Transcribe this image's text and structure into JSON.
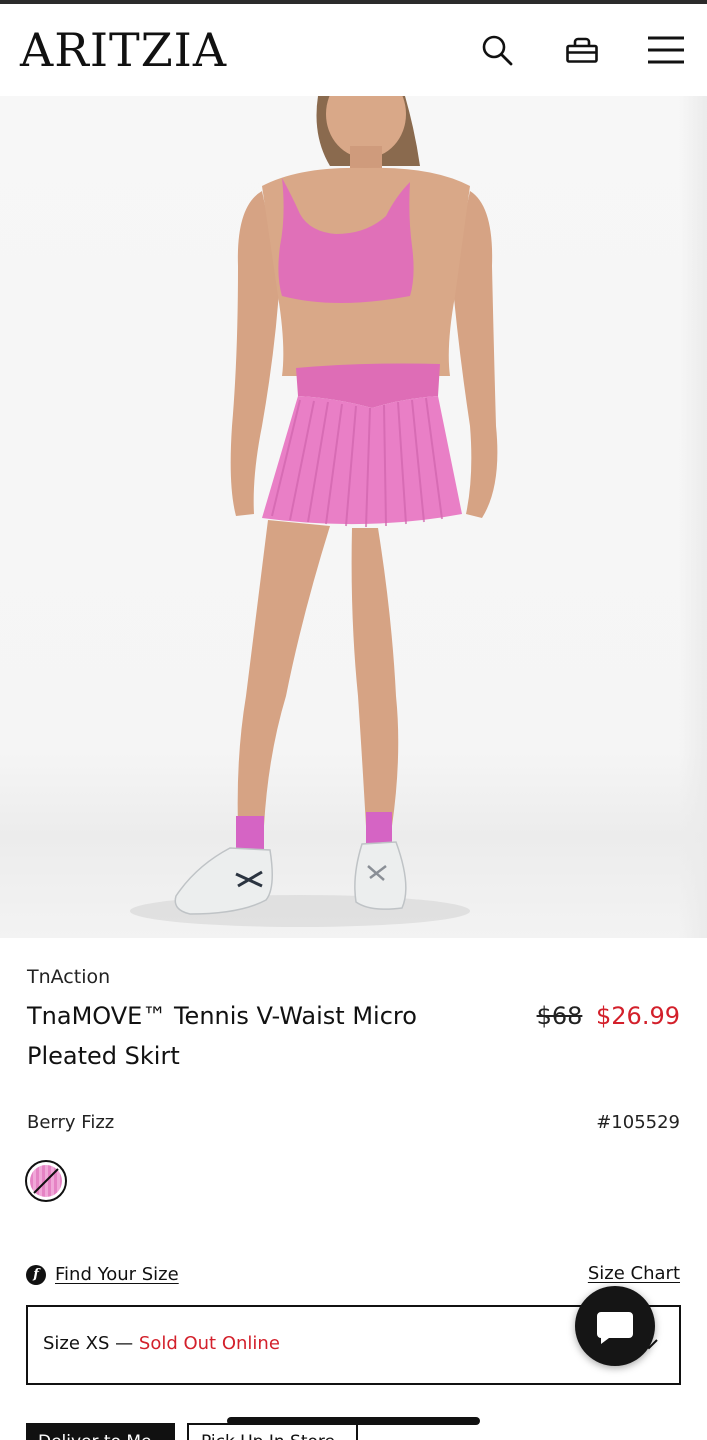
{
  "header": {
    "logo": "ARITZIA",
    "icons": [
      "search-icon",
      "shopping-bag-icon",
      "menu-icon"
    ]
  },
  "hero": {
    "image": "product-photo",
    "colors": {
      "top": "#e070b8",
      "skirt": "#e97fc6",
      "skirt_band": "#de6db6",
      "socks": "#d564c4",
      "skin": "#d9a888",
      "shoes": "#eceeee"
    }
  },
  "product": {
    "brand": "TnAction",
    "name": "TnaMOVE™ Tennis V-Waist Micro Pleated Skirt",
    "price_original": "$68",
    "price_sale": "$26.99",
    "color_name": "Berry Fizz",
    "sku": "#105529"
  },
  "size": {
    "find_your_size": "Find Your Size",
    "size_chart": "Size Chart",
    "selected_label": "Size XS —",
    "status": "Sold Out Online"
  },
  "fulfillment": {
    "deliver_label": "Deliver to Me",
    "pickup_label": "Pick Up In Store"
  },
  "theme": {
    "accent_sale": "#d3202b",
    "text": "#111111"
  }
}
